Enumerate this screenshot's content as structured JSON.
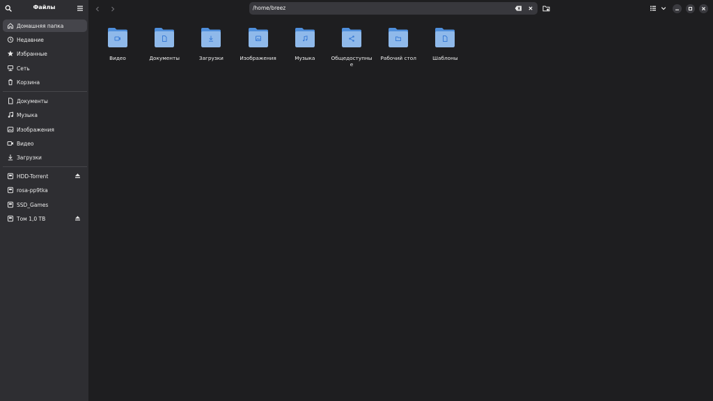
{
  "sidebar": {
    "title": "Файлы",
    "places": [
      {
        "label": "Домашняя папка",
        "icon": "home-icon",
        "active": true
      },
      {
        "label": "Недавние",
        "icon": "clock-icon"
      },
      {
        "label": "Избранные",
        "icon": "star-icon"
      },
      {
        "label": "Сеть",
        "icon": "network-icon"
      },
      {
        "label": "Корзина",
        "icon": "trash-icon"
      }
    ],
    "bookmarks": [
      {
        "label": "Документы",
        "icon": "document-icon"
      },
      {
        "label": "Музыка",
        "icon": "music-icon"
      },
      {
        "label": "Изображения",
        "icon": "image-icon"
      },
      {
        "label": "Видео",
        "icon": "video-icon"
      },
      {
        "label": "Загрузки",
        "icon": "download-icon"
      }
    ],
    "devices": [
      {
        "label": "HDD-Torrent",
        "icon": "drive-icon",
        "eject": true
      },
      {
        "label": "rosa-pp9tka",
        "icon": "drive-icon",
        "eject": false
      },
      {
        "label": "SSD_Games",
        "icon": "drive-icon",
        "eject": false
      },
      {
        "label": "Том 1,0 ТВ",
        "icon": "drive-icon",
        "eject": true
      }
    ]
  },
  "pathbar": {
    "path": "/home/breez"
  },
  "folders": [
    {
      "label": "Видео",
      "emblem": "video-icon"
    },
    {
      "label": "Документы",
      "emblem": "document-icon"
    },
    {
      "label": "Загрузки",
      "emblem": "download-icon"
    },
    {
      "label": "Изображения",
      "emblem": "image-icon"
    },
    {
      "label": "Музыка",
      "emblem": "music-icon"
    },
    {
      "label": "Общедоступные",
      "emblem": "share-icon"
    },
    {
      "label": "Рабочий стол",
      "emblem": "desktop-folder-icon"
    },
    {
      "label": "Шаблоны",
      "emblem": "template-icon"
    }
  ],
  "colors": {
    "folder_body": "#8fb9ea",
    "folder_tab": "#4f8fdc",
    "emblem": "#3a7bd5",
    "sidebar_bg": "#2e2e32",
    "main_bg": "#1e1e20"
  }
}
